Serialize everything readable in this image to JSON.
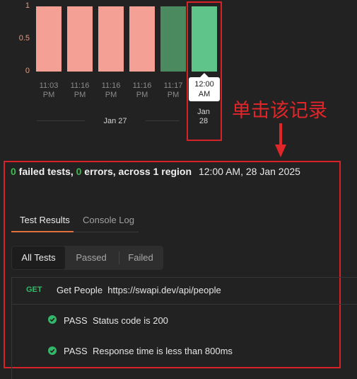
{
  "chart_data": {
    "type": "bar",
    "categories": [
      "11:03 PM",
      "11:16 PM",
      "11:16 PM",
      "11:16 PM",
      "11:17 PM",
      "12:00 AM"
    ],
    "values": [
      1,
      1,
      1,
      1,
      1,
      1
    ],
    "ylim": [
      0,
      1
    ],
    "yticks": [
      "1",
      "0.5",
      "0"
    ],
    "bar_colors": [
      "#f4a095",
      "#f4a095",
      "#f4a095",
      "#f4a095",
      "#4a8a5e",
      "#5ec489"
    ],
    "selected_index": 5,
    "date_labels": [
      "Jan 27",
      "Jan\n28"
    ]
  },
  "annotation": {
    "text": "单击该记录",
    "arrow": "↓"
  },
  "summary": {
    "failed_count": "0",
    "failed_label": " failed tests, ",
    "errors_count": "0",
    "errors_label": " errors, across 1 region",
    "timestamp": "12:00 AM, 28 Jan 2025"
  },
  "tabs": [
    "Test Results",
    "Console Log"
  ],
  "filters": [
    "All Tests",
    "Passed",
    "Failed"
  ],
  "request": {
    "method": "GET",
    "name": "Get People",
    "url": "https://swapi.dev/api/people"
  },
  "results": [
    {
      "status": "PASS",
      "text": "Status code is 200"
    },
    {
      "status": "PASS",
      "text": "Response time is less than 800ms"
    }
  ],
  "colors": {
    "accent_tab": "#e0703c",
    "pass": "#35b76a",
    "failed_bar": "#f4a095",
    "annotation_red": "#d8222a"
  }
}
